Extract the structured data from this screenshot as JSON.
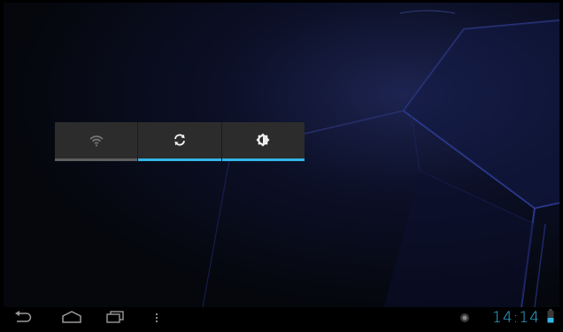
{
  "widget": {
    "wifi": {
      "state": "off"
    },
    "sync": {
      "state": "on"
    },
    "brightness": {
      "state": "on"
    }
  },
  "status_bar": {
    "time": "14:14"
  },
  "colors": {
    "accent": "#33b5e5",
    "indicator_off": "#5e5e5e",
    "widget_bg": "#2c2c2c",
    "nav_icon": "#9a9a9a"
  },
  "icons": {
    "back": "back-icon",
    "home": "home-icon",
    "recents": "recent-apps-icon",
    "menu": "menu-dots-icon",
    "wifi": "wifi-icon",
    "sync": "sync-icon",
    "brightness": "brightness-icon",
    "notification": "notification-icon",
    "battery": "battery-icon"
  }
}
